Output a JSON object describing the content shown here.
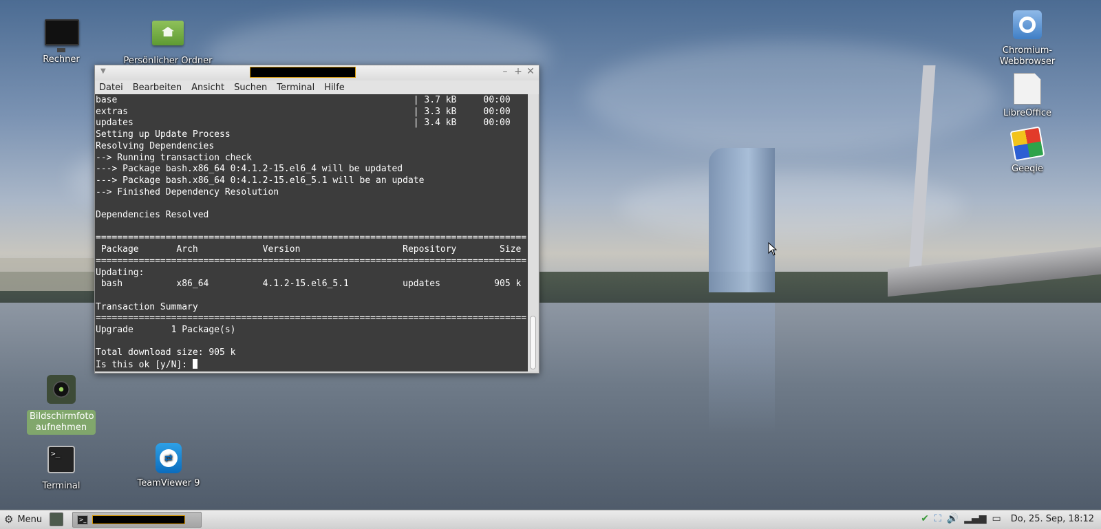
{
  "desktop": {
    "icons": [
      {
        "label": "Rechner",
        "icon": "computer-monitor-icon"
      },
      {
        "label": "Persönlicher Ordner",
        "icon": "home-folder-icon"
      },
      {
        "label": "Chromium-Webbrowser",
        "icon": "chromium-icon"
      },
      {
        "label": "LibreOffice",
        "icon": "document-icon"
      },
      {
        "label": "Geeqie",
        "icon": "image-viewer-icon"
      },
      {
        "label": "Bildschirmfoto aufnehmen",
        "icon": "camera-icon"
      },
      {
        "label": "Terminal",
        "icon": "terminal-icon"
      },
      {
        "label": "TeamViewer 9",
        "icon": "teamviewer-icon"
      }
    ]
  },
  "terminal_window": {
    "controls": {
      "minimize": "–",
      "maximize": "+",
      "close": "✕"
    },
    "menu": [
      "Datei",
      "Bearbeiten",
      "Ansicht",
      "Suchen",
      "Terminal",
      "Hilfe"
    ],
    "output": "base                                                       | 3.7 kB     00:00\nextras                                                     | 3.3 kB     00:00\nupdates                                                    | 3.4 kB     00:00\nSetting up Update Process\nResolving Dependencies\n--> Running transaction check\n---> Package bash.x86_64 0:4.1.2-15.el6_4 will be updated\n---> Package bash.x86_64 0:4.1.2-15.el6_5.1 will be an update\n--> Finished Dependency Resolution\n\nDependencies Resolved\n\n================================================================================\n Package       Arch            Version                   Repository        Size\n================================================================================\nUpdating:\n bash          x86_64          4.1.2-15.el6_5.1          updates          905 k\n\nTransaction Summary\n================================================================================\nUpgrade       1 Package(s)\n\nTotal download size: 905 k\nIs this ok [y/N]: "
  },
  "taskbar": {
    "menu_label": "Menu",
    "clock": "Do, 25. Sep, 18:12"
  },
  "colors": {
    "terminal_bg": "#3c3c3c",
    "terminal_fg": "#ffffff",
    "selection_green": "#86b069"
  }
}
